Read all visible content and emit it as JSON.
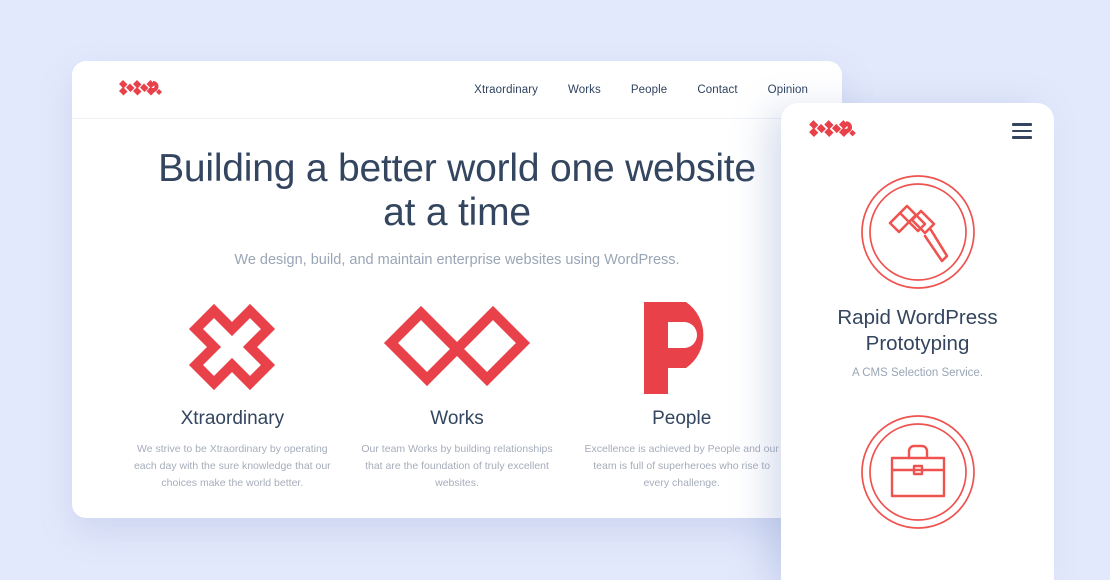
{
  "theme": {
    "background": "#e3e9fc",
    "accent_red": "#e8414a",
    "heading_color": "#33455f",
    "muted_text": "#a6adba",
    "card_background": "#ffffff"
  },
  "desktop": {
    "logo": "xwp-logo",
    "nav": [
      {
        "label": "Xtraordinary"
      },
      {
        "label": "Works"
      },
      {
        "label": "People"
      },
      {
        "label": "Contact"
      },
      {
        "label": "Opinion"
      }
    ],
    "hero": {
      "title": "Building a better world one website at a time",
      "subtitle": "We design, build, and maintain enterprise websites using WordPress."
    },
    "features": [
      {
        "icon": "x-mark-icon",
        "title": "Xtraordinary",
        "description": "We strive to be Xtraordinary by operating each day with the sure knowledge that our choices make the world better."
      },
      {
        "icon": "w-letter-icon",
        "title": "Works",
        "description": "Our team Works by building relationships that are the foundation of truly excellent websites."
      },
      {
        "icon": "p-letter-icon",
        "title": "People",
        "description": "Excellence is achieved by People and our team is full of superheroes who rise to every challenge."
      }
    ]
  },
  "mobile": {
    "logo": "xwp-logo",
    "menu_icon": "hamburger-menu-icon",
    "blocks": [
      {
        "icon": "mallet-circle-icon",
        "title": "Rapid WordPress Prototyping",
        "subtitle": "A CMS Selection Service."
      },
      {
        "icon": "briefcase-circle-icon",
        "title": "",
        "subtitle": ""
      }
    ]
  }
}
